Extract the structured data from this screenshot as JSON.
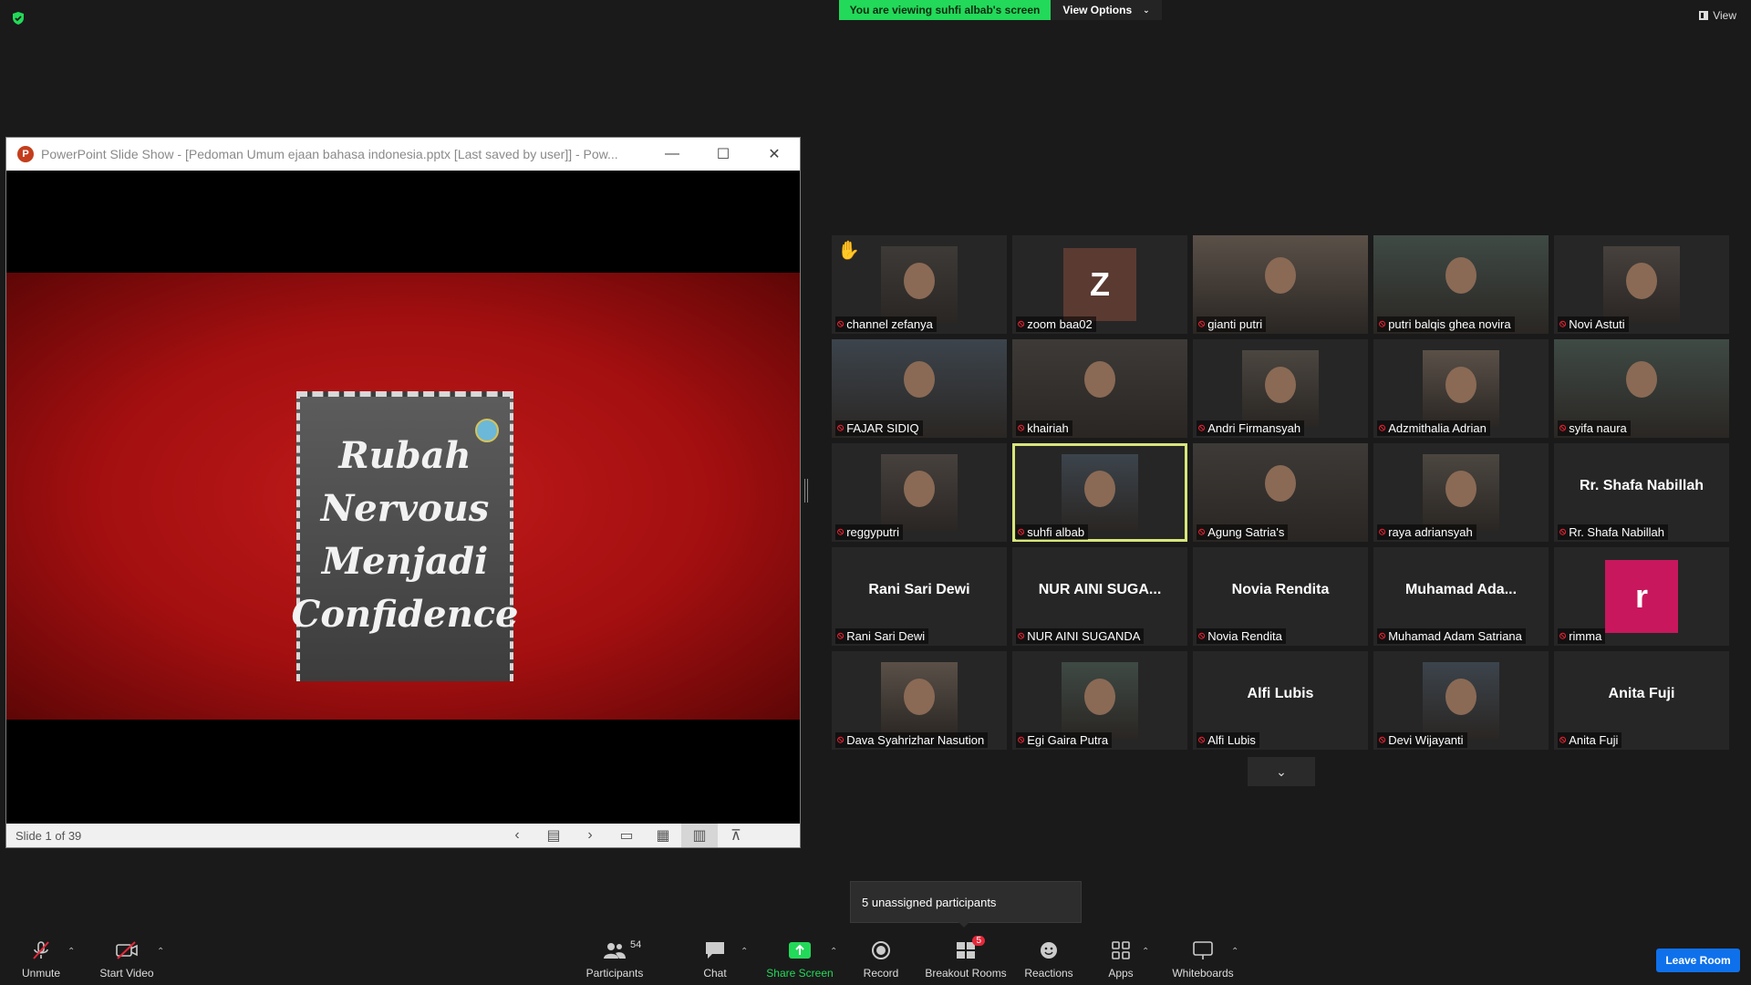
{
  "top": {
    "viewing_banner": "You are viewing suhfi albab's screen",
    "view_options": "View Options",
    "view_label": "View"
  },
  "ppt": {
    "title": "PowerPoint Slide Show - [Pedoman Umum ejaan bahasa indonesia.pptx [Last saved by user]] - Pow...",
    "slide_counter": "Slide 1 of 39",
    "slide_lines": [
      "Rubah",
      "Nervous",
      "Menjadi",
      "Confidence"
    ]
  },
  "participants": [
    {
      "name": "channel zefanya",
      "center": "",
      "hand": true
    },
    {
      "name": "zoom baa02",
      "center": "",
      "avatar_letter": "Z",
      "avatar_color": "#5b3a32"
    },
    {
      "name": "gianti putri",
      "center": ""
    },
    {
      "name": "putri balqis ghea novira",
      "center": ""
    },
    {
      "name": "Novi Astuti",
      "center": ""
    },
    {
      "name": "FAJAR SIDIQ",
      "center": ""
    },
    {
      "name": "khairiah",
      "center": ""
    },
    {
      "name": "Andri Firmansyah",
      "center": ""
    },
    {
      "name": "Adzmithalia Adrian",
      "center": ""
    },
    {
      "name": "syifa naura",
      "center": ""
    },
    {
      "name": "reggyputri",
      "center": ""
    },
    {
      "name": "suhfi albab",
      "center": "",
      "active": true
    },
    {
      "name": "Agung Satria's",
      "center": ""
    },
    {
      "name": "raya adriansyah",
      "center": ""
    },
    {
      "name": "Rr. Shafa Nabillah",
      "center": "Rr. Shafa Nabillah"
    },
    {
      "name": "Rani Sari Dewi",
      "center": "Rani Sari Dewi"
    },
    {
      "name": "NUR AINI SUGANDA",
      "center": "NUR AINI SUGA..."
    },
    {
      "name": "Novia Rendita",
      "center": "Novia Rendita"
    },
    {
      "name": "Muhamad Adam Satriana",
      "center": "Muhamad  Ada..."
    },
    {
      "name": "rimma",
      "center": "",
      "avatar_letter": "r",
      "avatar_color": "#c8175d"
    },
    {
      "name": "Dava Syahrizhar Nasution",
      "center": ""
    },
    {
      "name": "Egi Gaira Putra",
      "center": ""
    },
    {
      "name": "Alfi Lubis",
      "center": "Alfi Lubis"
    },
    {
      "name": "Devi Wijayanti",
      "center": ""
    },
    {
      "name": "Anita Fuji",
      "center": "Anita Fuji"
    }
  ],
  "tooltip": "5 unassigned participants",
  "toolbar": {
    "unmute": "Unmute",
    "start_video": "Start Video",
    "participants": "Participants",
    "participants_count": "54",
    "chat": "Chat",
    "share_screen": "Share Screen",
    "record": "Record",
    "breakout_rooms": "Breakout Rooms",
    "breakout_badge": "5",
    "reactions": "Reactions",
    "apps": "Apps",
    "whiteboards": "Whiteboards",
    "leave_room": "Leave Room"
  },
  "colors": {
    "banner_green": "#23d959",
    "leave_blue": "#0e71eb",
    "active_outline": "#d8e67a",
    "slide_red": "#b3141a"
  }
}
